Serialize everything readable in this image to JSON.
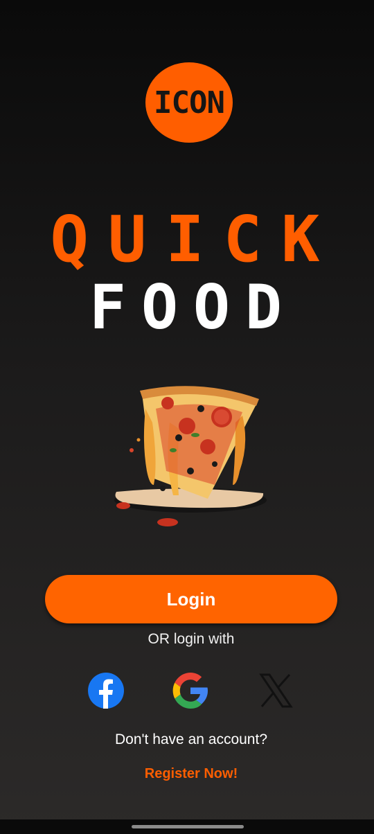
{
  "logo": {
    "text": "ICON"
  },
  "title": {
    "line1": "QUICK",
    "line2": "FOOD"
  },
  "actions": {
    "login_label": "Login",
    "or_text": "OR login with"
  },
  "social": [
    {
      "icon": "facebook-icon"
    },
    {
      "icon": "google-icon"
    },
    {
      "icon": "x-icon"
    }
  ],
  "footer": {
    "no_account": "Don't have an account?",
    "register_label": "Register Now!"
  },
  "colors": {
    "accent": "#ff5e00",
    "button": "#ff6400",
    "background_top": "#0a0a0a",
    "background_bottom": "#2c2a29"
  }
}
